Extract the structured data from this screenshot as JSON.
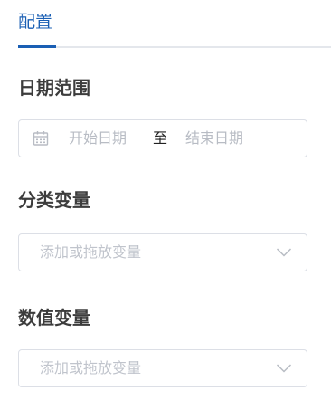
{
  "tabs": [
    {
      "label": "配置",
      "active": true
    }
  ],
  "sections": {
    "date": {
      "title": "日期范围",
      "start_placeholder": "开始日期",
      "separator": "至",
      "end_placeholder": "结束日期"
    },
    "categorical": {
      "title": "分类变量",
      "placeholder": "添加或拖放变量"
    },
    "numeric": {
      "title": "数值变量",
      "placeholder": "添加或拖放变量"
    }
  },
  "icons": {
    "date": "calendar-icon",
    "dropdown": "chevron-down-icon"
  },
  "colors": {
    "accent": "#1a5fb4",
    "border": "#dcdfe6",
    "placeholder": "#c0c4cc"
  }
}
